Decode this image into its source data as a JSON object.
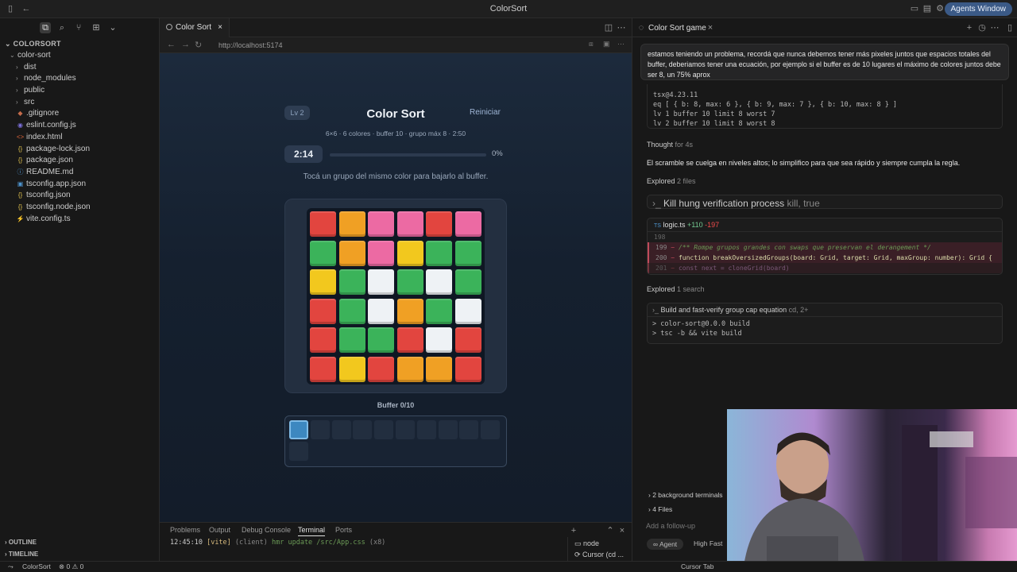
{
  "window": {
    "title": "ColorSort",
    "agents_button": "Agents Window"
  },
  "explorer": {
    "header": "COLORSORT",
    "root": "color-sort",
    "items": [
      {
        "label": "dist",
        "kind": "folder"
      },
      {
        "label": "node_modules",
        "kind": "folder"
      },
      {
        "label": "public",
        "kind": "folder"
      },
      {
        "label": "src",
        "kind": "folder"
      },
      {
        "label": ".gitignore",
        "kind": "file"
      },
      {
        "label": "eslint.config.js",
        "kind": "file"
      },
      {
        "label": "index.html",
        "kind": "file"
      },
      {
        "label": "package-lock.json",
        "kind": "file"
      },
      {
        "label": "package.json",
        "kind": "file"
      },
      {
        "label": "README.md",
        "kind": "file"
      },
      {
        "label": "tsconfig.app.json",
        "kind": "file"
      },
      {
        "label": "tsconfig.json",
        "kind": "file"
      },
      {
        "label": "tsconfig.node.json",
        "kind": "file"
      },
      {
        "label": "vite.config.ts",
        "kind": "file"
      }
    ],
    "outline": "OUTLINE",
    "timeline": "TIMELINE"
  },
  "editor": {
    "tab_label": "Color Sort",
    "url": "http://localhost:5174"
  },
  "game": {
    "level": "Lv 2",
    "title": "Color Sort",
    "restart": "Reiniciar",
    "subtitle": "6×6 · 6 colores · buffer 10 · grupo máx 8 · 2:50",
    "timer": "2:14",
    "progress_pct": "0%",
    "progress_value": 0,
    "hint": "Tocá un grupo del mismo color para bajarlo al buffer.",
    "grid": [
      [
        "red",
        "orange",
        "pink",
        "pink",
        "red",
        "pink"
      ],
      [
        "green",
        "orange",
        "pink",
        "yellow",
        "green",
        "green"
      ],
      [
        "yellow",
        "green",
        "white",
        "green",
        "white",
        "green"
      ],
      [
        "red",
        "green",
        "white",
        "orange",
        "green",
        "white"
      ],
      [
        "red",
        "green",
        "green",
        "red",
        "white",
        "red"
      ],
      [
        "red",
        "yellow",
        "red",
        "orange",
        "orange",
        "red"
      ]
    ],
    "colors": {
      "red": "#e2453f",
      "orange": "#f0a024",
      "pink": "#ec6aa3",
      "yellow": "#f2c81e",
      "green": "#3bb35a",
      "white": "#eef2f5"
    },
    "buffer_label": "Buffer 0/10",
    "buffer_slots": 11,
    "buffer_filled": [
      0
    ]
  },
  "panel": {
    "tabs": [
      "Problems",
      "Output",
      "Debug Console",
      "Terminal",
      "Ports"
    ],
    "active_tab": "Terminal",
    "terminal_time": "12:45:10",
    "terminal_vite": "[vite]",
    "terminal_client": "(client)",
    "terminal_msg": "hmr update /src/App.css",
    "terminal_count": "(x8)",
    "terminals": [
      "node",
      "Cursor (cd ..."
    ]
  },
  "chat": {
    "title": "Color Sort game",
    "user_message": "estamos teniendo un problema, recordá que nunca debemos tener más pixeles juntos que espacios totales del buffer, deberiamos tener una ecuación, por ejemplo si el buffer es de 10 lugares el máximo de colores juntos debe ser 8, un 75% aprox",
    "code_lines": [
      "tsx@4.23.11",
      "eq [ { b: 8, max: 6 }, { b: 9, max: 7 }, { b: 10, max: 8 } ]",
      "lv 1 buffer 10 limit 8 worst 7",
      "lv 2 buffer 10 limit 8 worst 8"
    ],
    "thought_label": "Thought",
    "thought_time": "for 4s",
    "assistant_text": "El scramble se cuelga en niveles altos; lo simplifico para que sea rápido y siempre cumpla la regla.",
    "explored1_label": "Explored",
    "explored1_detail": "2 files",
    "kill_label": "Kill hung verification process",
    "kill_detail": "kill, true",
    "diff_file": "logic.ts",
    "diff_add": "+110",
    "diff_del": "-197",
    "diff_lines": [
      {
        "num": "198",
        "text": ""
      },
      {
        "num": "199",
        "text": "/** Rompe grupos grandes con swaps que preservan el derangement */"
      },
      {
        "num": "200",
        "text": "function breakOversizedGroups(board: Grid, target: Grid, maxGroup: number): Grid {"
      },
      {
        "num": "201",
        "text": "  const next = cloneGrid(board)"
      }
    ],
    "explored2_label": "Explored",
    "explored2_detail": "1 search",
    "build_label": "Build and fast-verify group cap equation",
    "build_detail": "cd, 2+",
    "build_out": [
      "> color-sort@0.0.0 build",
      "> tsc -b && vite build"
    ],
    "bg_terminals": "2 background terminals",
    "files": "4 Files",
    "followup_placeholder": "Add a follow-up",
    "mode": "Agent",
    "model": "High Fast"
  },
  "status": {
    "branch": "ColorSort",
    "errors": "0",
    "warnings": "0",
    "cursor_tab": "Cursor Tab"
  }
}
